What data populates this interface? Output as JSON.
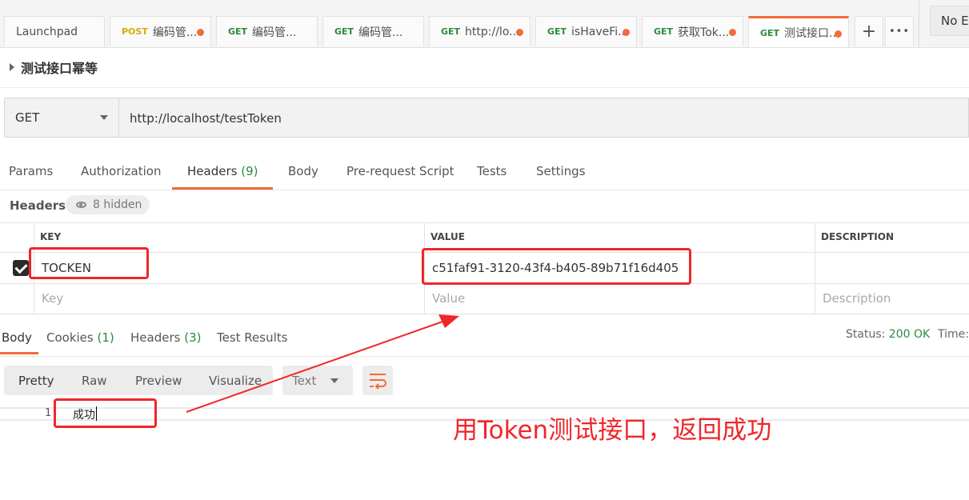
{
  "tabs": [
    {
      "method": "",
      "title": "Launchpad",
      "dot": false,
      "active": false
    },
    {
      "method": "POST",
      "title": "编码管...",
      "dot": true,
      "active": false
    },
    {
      "method": "GET",
      "title": "编码管...",
      "dot": false,
      "active": false
    },
    {
      "method": "GET",
      "title": "编码管...",
      "dot": false,
      "active": false
    },
    {
      "method": "GET",
      "title": "http://lo...",
      "dot": true,
      "active": false
    },
    {
      "method": "GET",
      "title": "isHaveFi...",
      "dot": true,
      "active": false
    },
    {
      "method": "GET",
      "title": "获取Tok...",
      "dot": true,
      "active": false
    },
    {
      "method": "GET",
      "title": "测试接口...",
      "dot": true,
      "active": true
    }
  ],
  "tab_controls": {
    "add": "+",
    "more": "•••"
  },
  "environment": "No En",
  "request_name": "测试接口幂等",
  "request": {
    "method": "GET",
    "url": "http://localhost/testToken"
  },
  "request_tabs": {
    "params": "Params",
    "authorization": "Authorization",
    "headers": "Headers",
    "headers_count": "(9)",
    "body": "Body",
    "prerequest": "Pre-request Script",
    "tests": "Tests",
    "settings": "Settings"
  },
  "headers_section": {
    "label": "Headers",
    "hidden": "8 hidden"
  },
  "headers_table": {
    "columns": {
      "key": "KEY",
      "value": "VALUE",
      "description": "DESCRIPTION"
    },
    "rows": [
      {
        "key": "TOCKEN",
        "value": "c51faf91-3120-43f4-b405-89b71f16d405",
        "description": "",
        "checked": true
      }
    ],
    "placeholders": {
      "key": "Key",
      "value": "Value",
      "description": "Description"
    }
  },
  "response_tabs": {
    "body": "Body",
    "cookies": "Cookies",
    "cookies_count": "(1)",
    "headers": "Headers",
    "headers_count": "(3)",
    "test_results": "Test Results"
  },
  "response_status": {
    "label": "Status:",
    "value": "200 OK",
    "time_label": "Time:"
  },
  "view_modes": [
    "Pretty",
    "Raw",
    "Preview",
    "Visualize"
  ],
  "format": "Text",
  "response_body": {
    "line_number": "1",
    "text": "成功"
  },
  "annotation": {
    "text": "用Token测试接口，返回成功",
    "color": "#f0262b"
  },
  "colors": {
    "accent": "#f26b3a",
    "success": "#2a8a3e",
    "post": "#d9a900"
  }
}
